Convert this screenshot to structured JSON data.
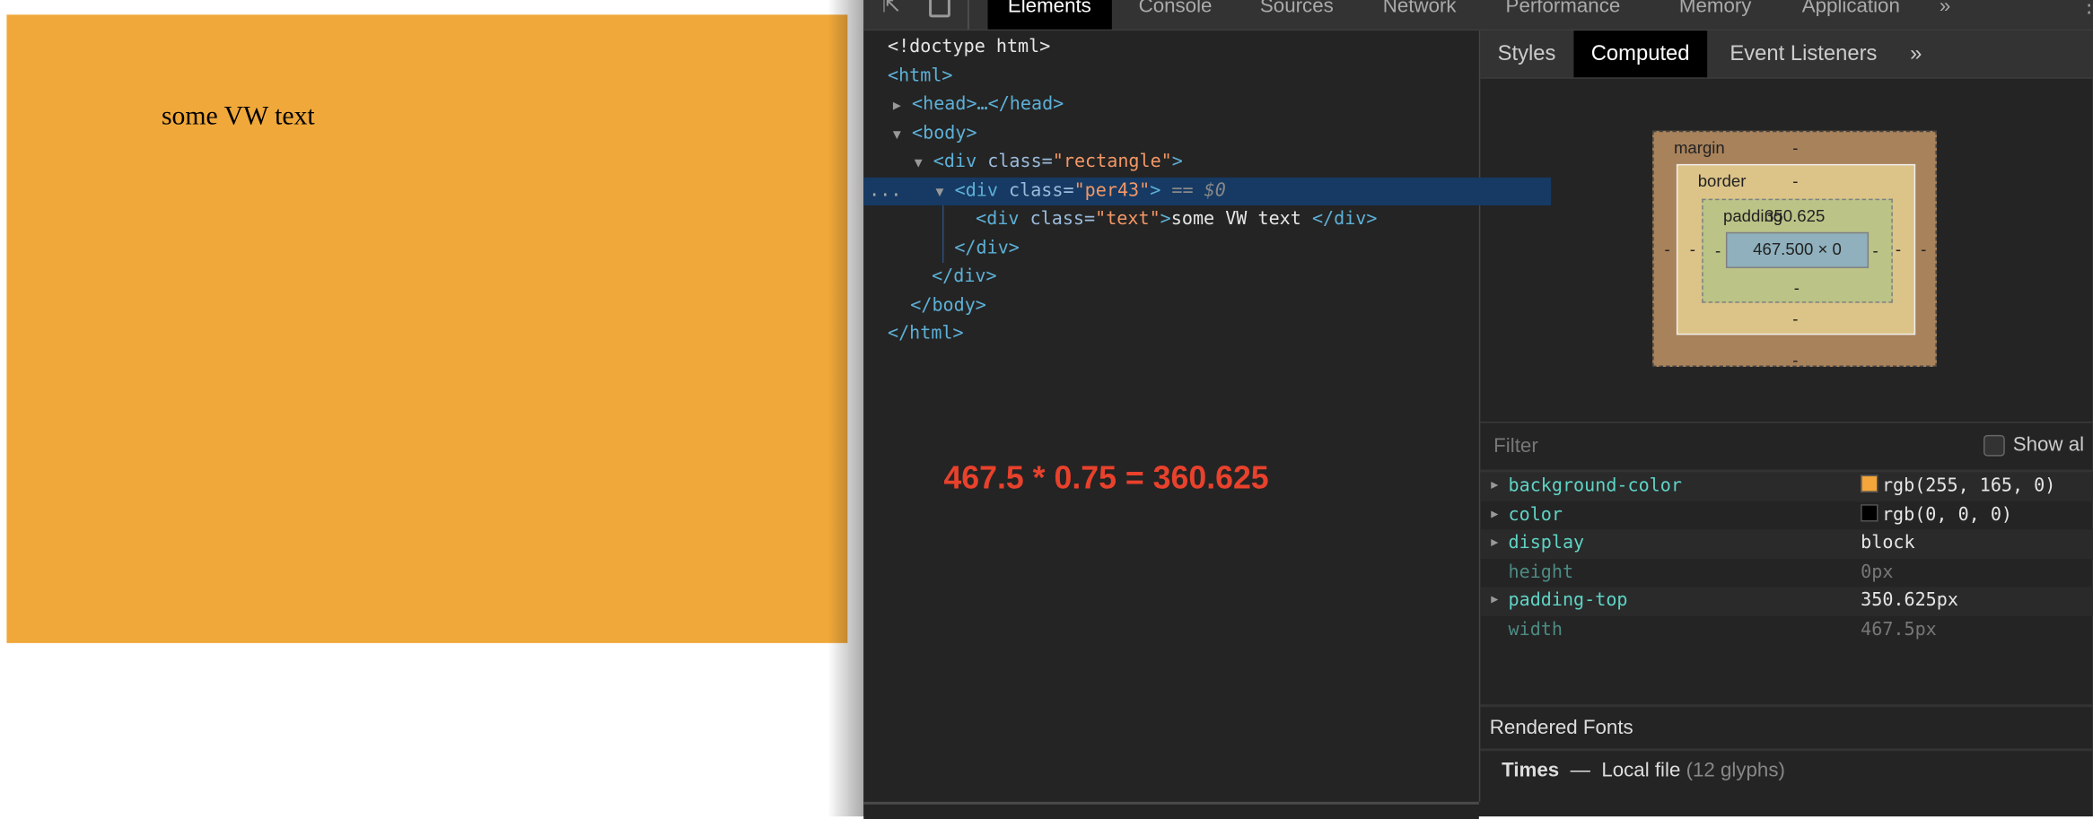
{
  "page": {
    "text": "some VW text",
    "rect_color": "#f0a83a"
  },
  "devtools": {
    "tabs": [
      "Elements",
      "Console",
      "Sources",
      "Network",
      "Performance",
      "Memory",
      "Application",
      "»"
    ],
    "active_tab": "Elements",
    "dom": {
      "doctype": "<!doctype html>",
      "html_open": "<html>",
      "head": "<head>…</head>",
      "body_open": "<body>",
      "div_open": "<div ",
      "class_attr": "class=",
      "rectangle_val": "\"rectangle\"",
      "per43_val": "\"per43\"",
      "text_val": "\"text\"",
      "close_bracket": ">",
      "selected_marker": " == $0",
      "text_content": "some VW text ",
      "div_close": "</div>",
      "body_close": "</body>",
      "html_close": "</html>",
      "ellipsis": "..."
    },
    "annotation": "467.5 * 0.75 = 360.625",
    "sidebar_tabs": [
      "Styles",
      "Computed",
      "Event Listeners",
      "»"
    ],
    "box_model": {
      "margin_label": "margin",
      "border_label": "border",
      "padding_label": "padding",
      "padding_top": "350.625",
      "content": "467.500 × 0",
      "dash": "-"
    },
    "filter_placeholder": "Filter",
    "show_all": "Show al",
    "properties": [
      {
        "name": "background-color",
        "value": "rgb(255, 165, 0)",
        "swatch": "#f5a63a"
      },
      {
        "name": "color",
        "value": "rgb(0, 0, 0)",
        "swatch": "#000000"
      },
      {
        "name": "display",
        "value": "block"
      },
      {
        "name": "height",
        "value": "0px"
      },
      {
        "name": "padding-top",
        "value": "350.625px"
      },
      {
        "name": "width",
        "value": "467.5px"
      }
    ],
    "rendered_fonts": {
      "header": "Rendered Fonts",
      "font": "Times",
      "dash": "—",
      "source": "Local file",
      "glyphs": "(12 glyphs)"
    }
  }
}
